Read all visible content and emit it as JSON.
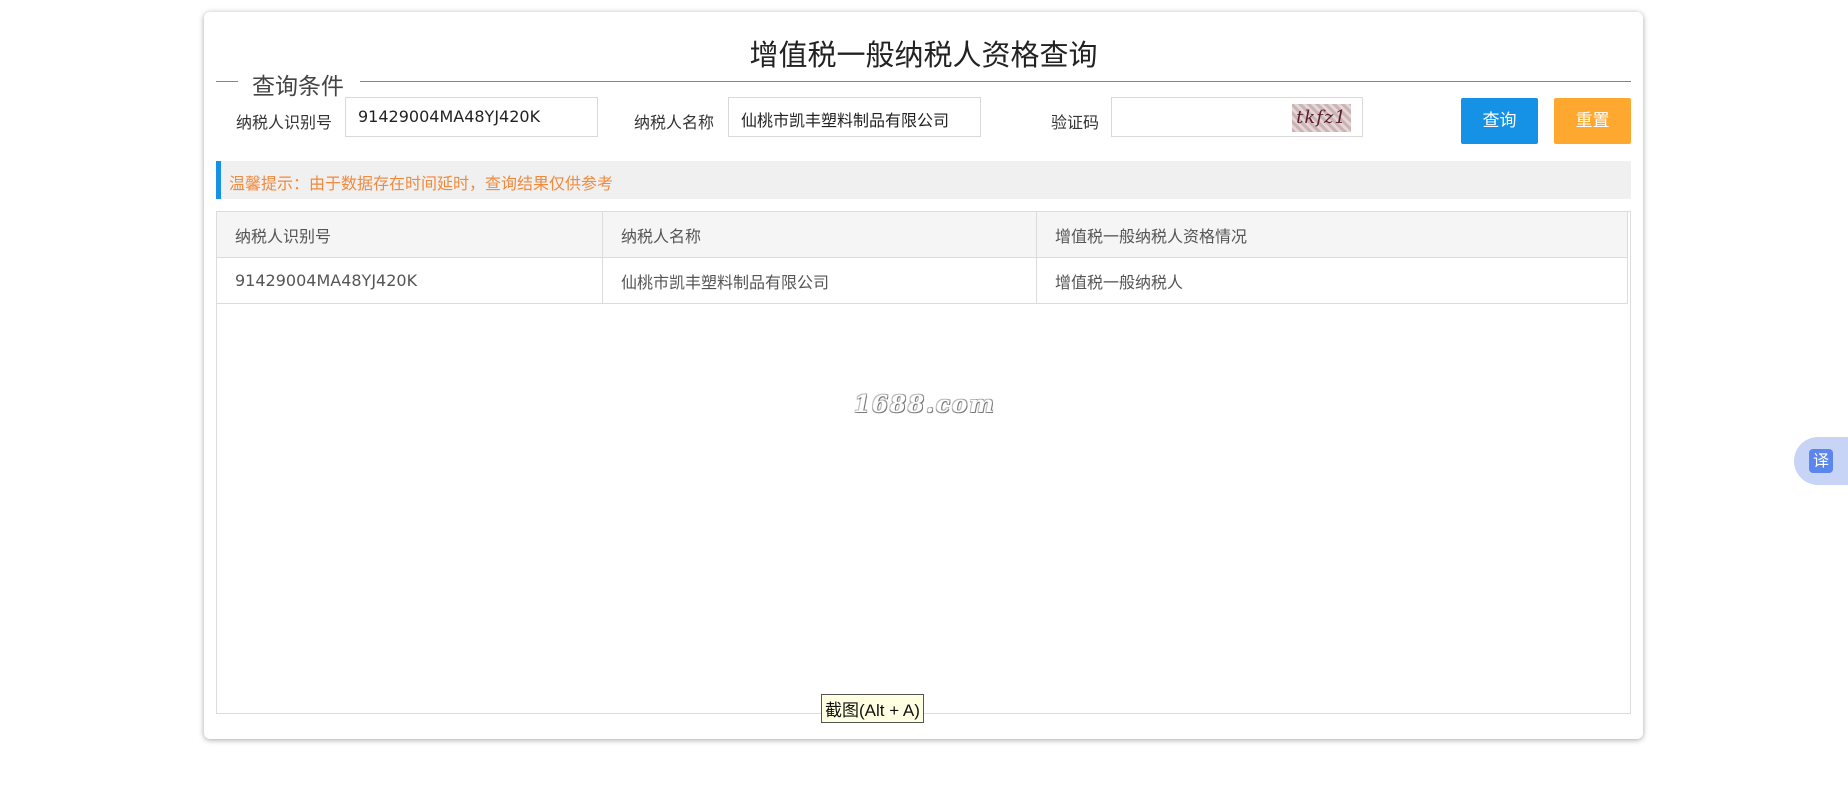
{
  "page": {
    "title": "增值税一般纳税人资格查询"
  },
  "query_form": {
    "legend": "查询条件",
    "taxpayer_id_label": "纳税人识别号",
    "taxpayer_id_value": "91429004MA48YJ420K",
    "taxpayer_name_label": "纳税人名称",
    "taxpayer_name_value": "仙桃市凯丰塑料制品有限公司",
    "captcha_label": "验证码",
    "captcha_value": "",
    "captcha_image_text": "tkfz1",
    "query_button": "查询",
    "reset_button": "重置"
  },
  "tip": {
    "text": "温馨提示：由于数据存在时间延时，查询结果仅供参考"
  },
  "results": {
    "columns": [
      "纳税人识别号",
      "纳税人名称",
      "增值税一般纳税人资格情况"
    ],
    "rows": [
      [
        "91429004MA48YJ420K",
        "仙桃市凯丰塑料制品有限公司",
        "增值税一般纳税人"
      ]
    ]
  },
  "watermark": "1688.com",
  "tooltip": "截图(Alt + A)",
  "translate_button": "译",
  "colors": {
    "accent_blue": "#1592e6",
    "reset_orange": "#ffa830",
    "tip_text": "#f18a3d"
  }
}
